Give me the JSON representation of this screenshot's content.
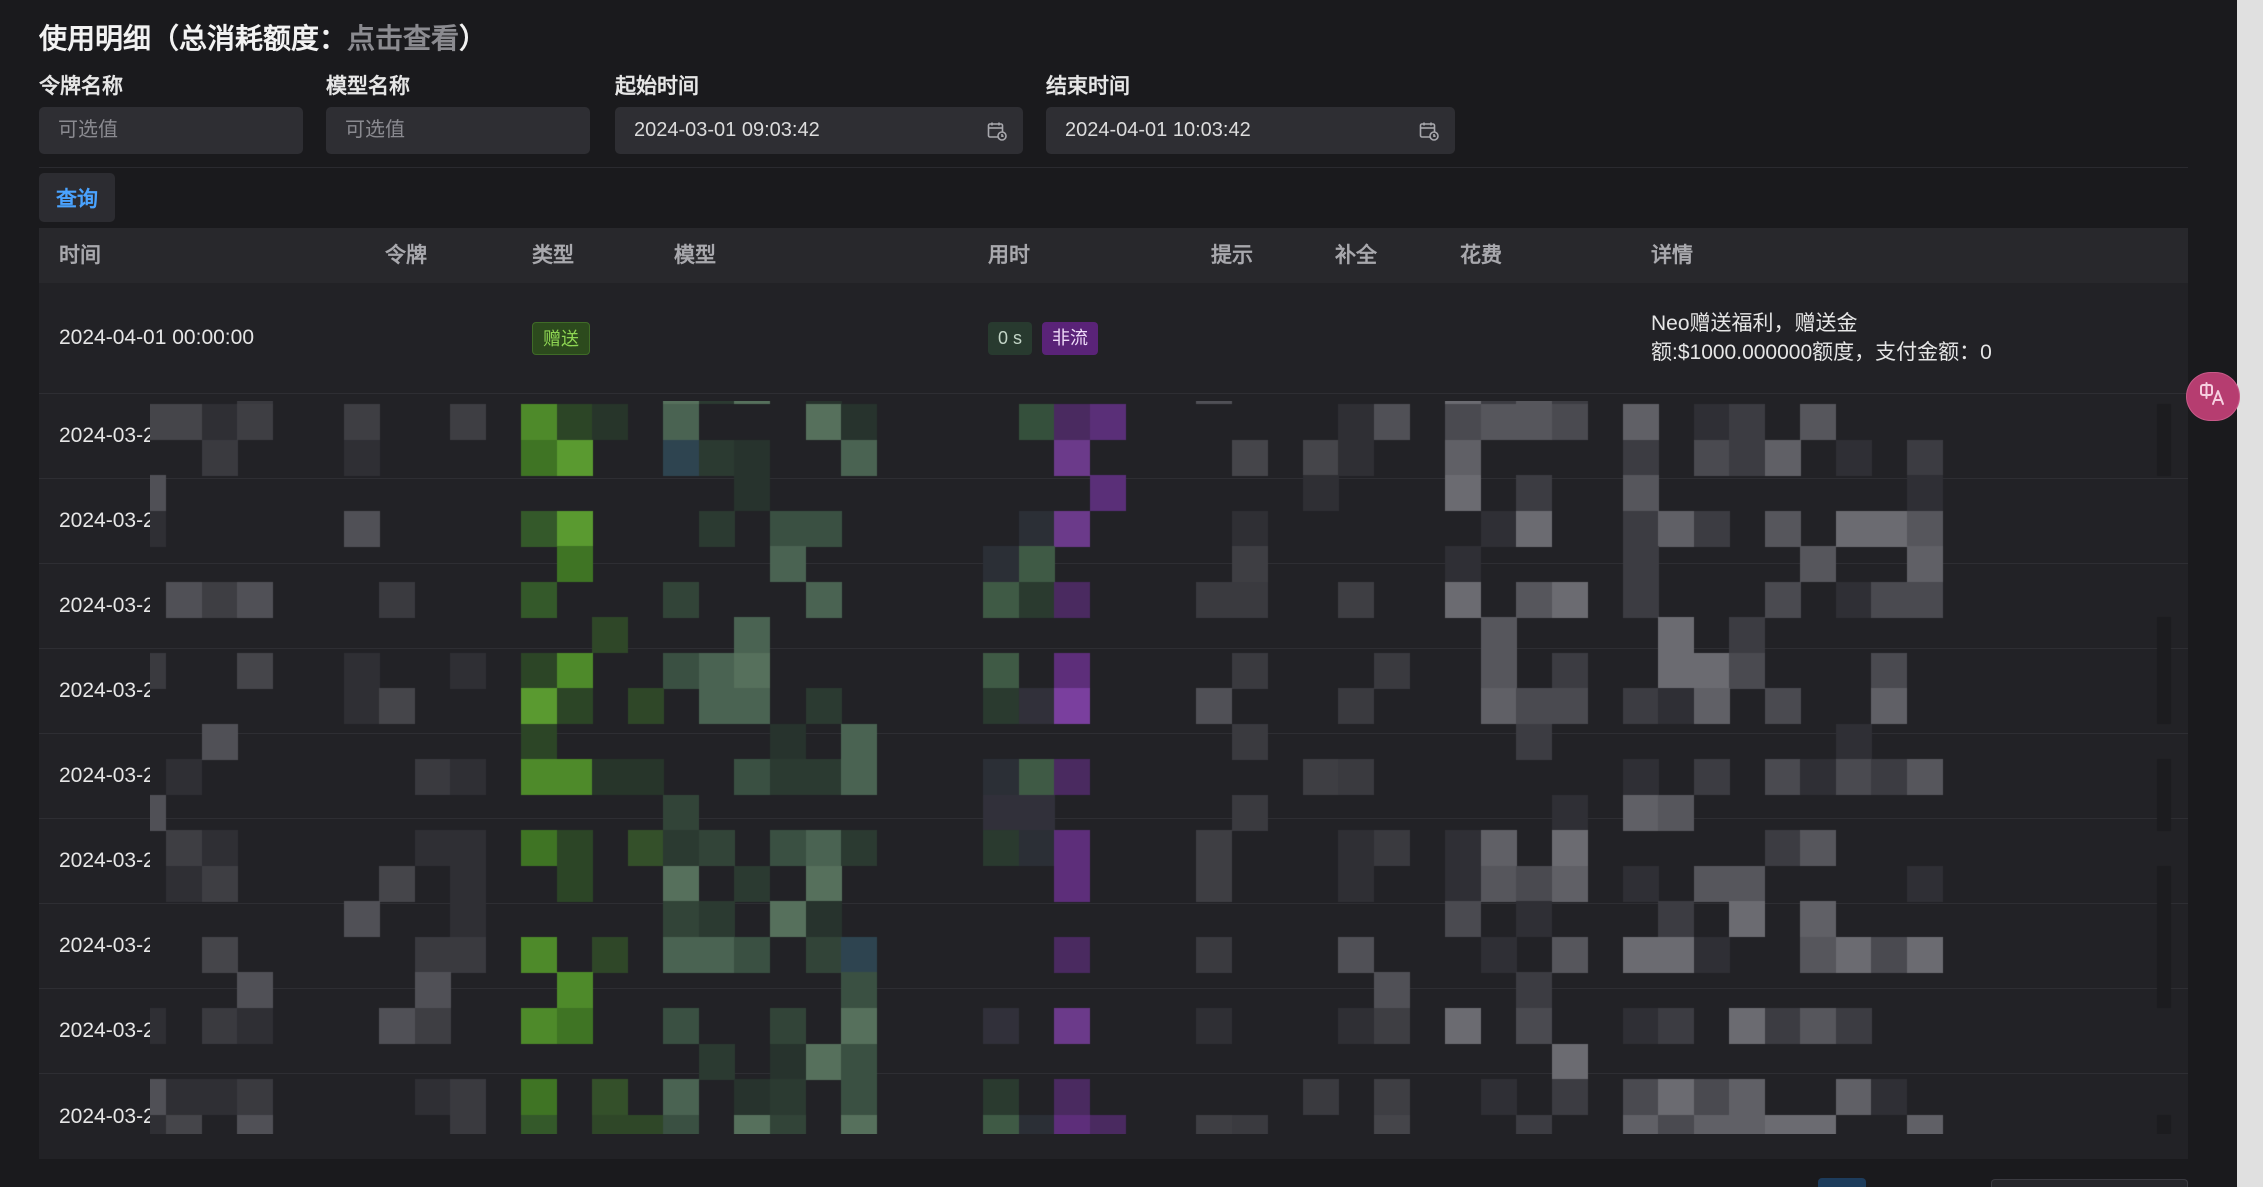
{
  "page": {
    "title_prefix": "使用明细（总消耗额度：",
    "title_link": "点击查看",
    "title_suffix": "）"
  },
  "filters": {
    "token_name": {
      "label": "令牌名称",
      "placeholder": "可选值"
    },
    "model_name": {
      "label": "模型名称",
      "placeholder": "可选值"
    },
    "start_time": {
      "label": "起始时间",
      "value": "2024-03-01 09:03:42"
    },
    "end_time": {
      "label": "结束时间",
      "value": "2024-04-01 10:03:42"
    },
    "query_label": "查询"
  },
  "table": {
    "columns": [
      "时间",
      "令牌",
      "类型",
      "模型",
      "用时",
      "提示",
      "补全",
      "花费",
      "详情"
    ],
    "rows": [
      {
        "time": "2024-04-01 00:00:00",
        "type": "赠送",
        "duration": "0 s",
        "stream": "非流",
        "detail_lines": [
          "Neo赠送福利，赠送金",
          "额:$1000.000000额度，支付金额：0"
        ]
      },
      {
        "time": "2024-03-2"
      },
      {
        "time": "2024-03-2"
      },
      {
        "time": "2024-03-2"
      },
      {
        "time": "2024-03-2"
      },
      {
        "time": "2024-03-2"
      },
      {
        "time": "2024-03-2"
      },
      {
        "time": "2024-03-2"
      },
      {
        "time": "2024-03-2"
      },
      {
        "time": "2024-03-2"
      }
    ]
  },
  "icons": {
    "start_time": "calendar-icon",
    "end_time": "calendar-icon",
    "floating_button": "translate-icon"
  },
  "theme": {
    "accent": "#4aa3ff",
    "gift-tag-bg": "#2c4a1d",
    "gift-tag-border": "#3f6b27",
    "gift-tag-text": "#8ed653",
    "duration-tag-bg": "#283a2f",
    "duration-tag-text": "#c3d5c7",
    "stream-tag-bg": "#5a2378",
    "stream-tag-text": "#efdcf9",
    "float-button": "#b63d70"
  }
}
